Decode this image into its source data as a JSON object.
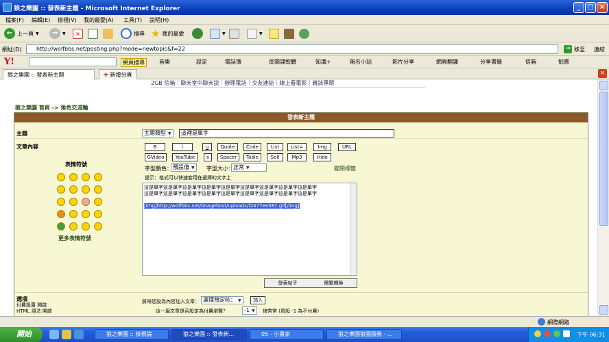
{
  "window": {
    "title": "狼之樂園 :: 發表新主題 - Microsoft Internet Explorer"
  },
  "menu": [
    "檔案(F)",
    "編輯(E)",
    "檢視(V)",
    "我的最愛(A)",
    "工具(T)",
    "說明(H)"
  ],
  "toolbar": {
    "back": "上一頁",
    "search": "搜尋",
    "favorites": "我的最愛"
  },
  "address": {
    "label": "網址(D)",
    "url": "http://wolfbbs.net/posting.php?mode=newtopic&f=22",
    "go": "移至",
    "links": "連結"
  },
  "yahoo": {
    "items": [
      "網頁搜尋",
      "音樂",
      "設定",
      "電話簿",
      "反間諜軟體",
      "知識+",
      "無名小站",
      "影片分享",
      "網頁翻譯",
      "分享書籤",
      "信箱",
      "拍賣"
    ]
  },
  "tabs": {
    "current": "狼之樂園 :: 發表新主題",
    "new_tab": "新增分頁"
  },
  "page": {
    "top_links": "2GB 信箱｜聊天室中聊天說｜辦理電話｜交友連結｜線上看電影｜雜誌專題",
    "breadcrumb": "狼之樂園 首頁 -> 角色交流輪",
    "form_title": "發表新主題",
    "subject_label": "主題",
    "subject_type": "主題類型",
    "subject_value": "這裡是單字",
    "body_label": "文章內容",
    "emoticons_label": "表情符號",
    "more_emoticons": "更多表情符號",
    "format_buttons": [
      "B",
      "i",
      "u",
      "Quote",
      "Code",
      "List",
      "List=",
      "Img",
      "URL",
      "GVideo",
      "YouTube",
      "s",
      "Spacer",
      "Table",
      "Sell",
      "Mp3",
      "Hide"
    ],
    "font_color_label": "字型顏色：",
    "font_color_value": "預設值",
    "font_size_label": "字型大小：",
    "font_size_value": "正常",
    "close_tags": "關閉標籤",
    "tip": "提示：格式可以快速套用在選擇的文字上",
    "body_text_line1": "這是單字這是單字這是單字這是單字這是單字這是單字這是單字這是單字這是單字",
    "body_text_line2": "這是單字這是單字這是單字這是單字這是單字這是單字這是單字這是單字這是單字",
    "body_img_tag": "[img]http://wolfbbs.net/imagehost/uploads/f2477ee587.gif[/img]",
    "submit_left": "發表帖子",
    "submit_right": "簡繁轉換",
    "options_label": "選項",
    "option_1": "付費設置 開啟",
    "option_2": "HTML 語法 開啟",
    "add_to_label": "將帶您設為內容加入文章：",
    "add_to_select": "選擇預定帖：",
    "add_to_btn": "加入",
    "price_label": "這一篇文章是否設定為付費瀏覽？",
    "price_value": "-1",
    "price_hint": "狼幣幣 (預設 -1 為不付費)"
  },
  "status": {
    "zone": "網際網路"
  },
  "taskbar": {
    "start": "開始",
    "tasks": [
      "狼之樂園 :: 檢視論",
      "狼之樂園 :: 發表新...",
      "05 - 小畫家",
      "狼之樂園狼圖服務 - ..."
    ],
    "clock": "下午 06:31"
  }
}
